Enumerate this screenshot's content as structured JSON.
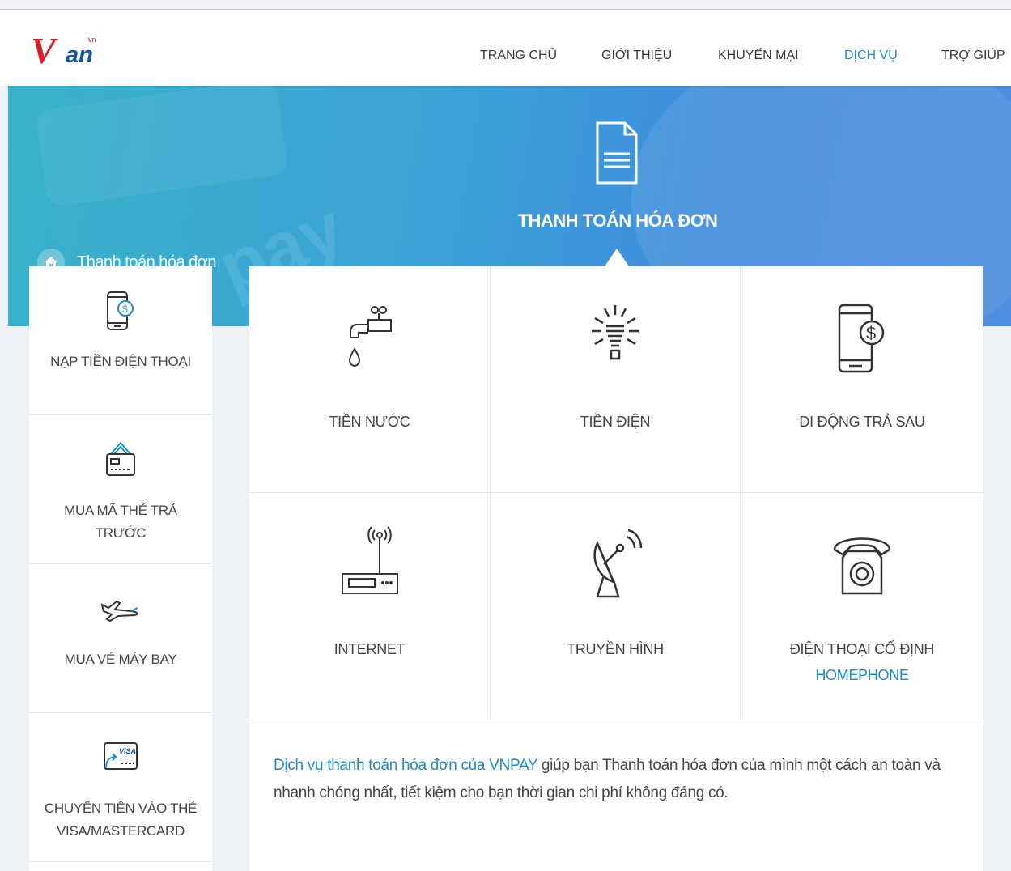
{
  "header": {
    "logo": {
      "main": "V",
      "sub": "an",
      "tld": "vn"
    },
    "nav": [
      {
        "label": "TRANG CHỦ",
        "active": false
      },
      {
        "label": "GIỚI THIỆU",
        "active": false
      },
      {
        "label": "KHUYẾN MẠI",
        "active": false
      },
      {
        "label": "DỊCH VỤ",
        "active": true
      },
      {
        "label": "TRỢ GIÚP",
        "active": false
      }
    ]
  },
  "banner": {
    "breadcrumb": "Thanh toán hóa đơn",
    "breadcrumb_icon": "home-icon",
    "title": "THANH TOÁN HÓA ĐƠN",
    "title_icon": "document-icon",
    "watermark": "pay"
  },
  "sidebar": {
    "items": [
      {
        "label": "NẠP TIỀN ĐIỆN THOẠI",
        "icon": "phone-dollar-icon"
      },
      {
        "label": "MUA MÃ THẺ TRẢ TRƯỚC",
        "icon": "prepaid-card-icon"
      },
      {
        "label": "MUA VÉ MÁY BAY",
        "icon": "airplane-icon"
      },
      {
        "label": "CHUYỂN TIỀN VÀO THẺ VISA/MASTERCARD",
        "icon": "visa-card-icon"
      }
    ]
  },
  "services": [
    {
      "label": "TIỀN NƯỚC",
      "icon": "water-faucet-icon"
    },
    {
      "label": "TIỀN ĐIỆN",
      "icon": "light-bulb-icon"
    },
    {
      "label": "DI ĐỘNG TRẢ SAU",
      "icon": "phone-dollar-icon"
    },
    {
      "label": "INTERNET",
      "icon": "router-icon"
    },
    {
      "label": "TRUYỀN HÌNH",
      "icon": "satellite-dish-icon"
    },
    {
      "label": "ĐIỆN THOẠI CỐ ĐỊNH",
      "sublabel": "HOMEPHONE",
      "icon": "telephone-icon"
    }
  ],
  "description": {
    "link": "Dịch vụ thanh toán hóa đơn của VNPAY",
    "text": " giúp bạn Thanh toán hóa đơn của mình một cách an toàn và nhanh chóng nhất, tiết kiệm cho bạn thời gian chi phí không đáng có."
  },
  "colors": {
    "accent": "#1e8bd0",
    "brand_red": "#d8202a",
    "brand_blue": "#12559e",
    "banner": "#3ba4d6"
  }
}
